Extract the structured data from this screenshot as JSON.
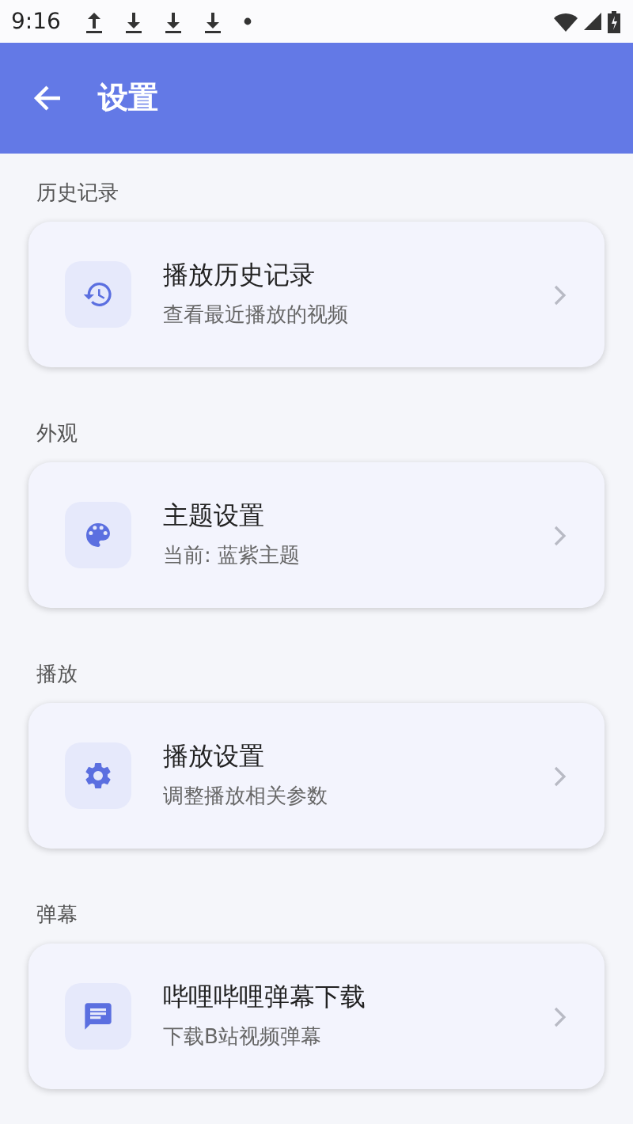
{
  "status_bar": {
    "time": "9:16",
    "indicators": [
      {
        "kind": "upload"
      },
      {
        "kind": "download"
      },
      {
        "kind": "download"
      },
      {
        "kind": "download"
      },
      {
        "kind": "dot"
      }
    ]
  },
  "app_bar": {
    "title": "设置"
  },
  "sections": [
    {
      "label": "历史记录",
      "items": [
        {
          "kind": "history",
          "title": "播放历史记录",
          "subtitle": "查看最近播放的视频"
        }
      ]
    },
    {
      "label": "外观",
      "items": [
        {
          "kind": "palette",
          "title": "主题设置",
          "subtitle": "当前: 蓝紫主题"
        }
      ]
    },
    {
      "label": "播放",
      "items": [
        {
          "kind": "settings",
          "title": "播放设置",
          "subtitle": "调整播放相关参数"
        }
      ]
    },
    {
      "label": "弹幕",
      "items": [
        {
          "kind": "message",
          "title": "哔哩哔哩弹幕下载",
          "subtitle": "下载B站视频弹幕"
        }
      ]
    }
  ]
}
